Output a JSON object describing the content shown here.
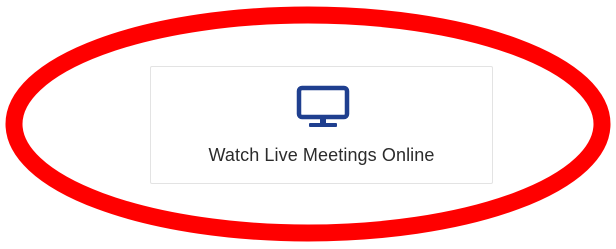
{
  "card": {
    "label": "Watch Live Meetings Online",
    "icon": "monitor-icon"
  },
  "colors": {
    "highlight_ring": "#ff0000",
    "icon": "#1f3f8f",
    "card_border": "#e3e3e3",
    "text": "#2b2b2b"
  }
}
